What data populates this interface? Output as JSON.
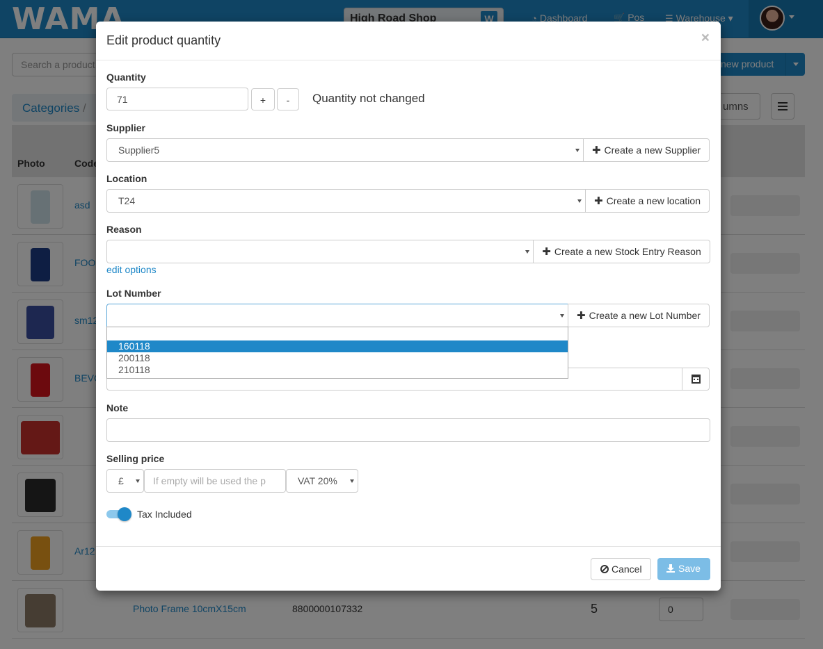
{
  "navbar": {
    "logo": "WAMA",
    "shop": "High Road Shop",
    "links": [
      {
        "icon": "dashboard-icon",
        "label": "Dashboard"
      },
      {
        "icon": "cart-icon",
        "label": "Pos"
      },
      {
        "icon": "bars-icon",
        "label": "Warehouse"
      }
    ]
  },
  "background": {
    "search_placeholder": "Search a product",
    "new_product": "new product",
    "breadcrumb": "Categories",
    "columns_btn": "umns",
    "headers": [
      "Photo",
      "Code"
    ],
    "rows": [
      {
        "code": "asd"
      },
      {
        "code": "FOO"
      },
      {
        "code": "sm12"
      },
      {
        "code": "BEVC"
      },
      {
        "code": ""
      },
      {
        "code": ""
      },
      {
        "code": "Ar12"
      },
      {
        "code": "Photo Frame 10cmX15cm",
        "barcode": "8800000107332",
        "stock": "5",
        "qty": "0"
      }
    ]
  },
  "modal": {
    "title": "Edit product quantity",
    "close": "×",
    "quantity": {
      "label": "Quantity",
      "value": "71",
      "plus": "+",
      "minus": "-",
      "status": "Quantity not changed"
    },
    "supplier": {
      "label": "Supplier",
      "value": "Supplier5",
      "create": "Create a new Supplier"
    },
    "location": {
      "label": "Location",
      "value": "T24",
      "create": "Create a new location"
    },
    "reason": {
      "label": "Reason",
      "value": "",
      "create": "Create a new Stock Entry Reason",
      "edit_link": "edit options"
    },
    "lot": {
      "label": "Lot Number",
      "value": "",
      "create": "Create a new Lot Number",
      "options": [
        "160118",
        "200118",
        "210118"
      ],
      "highlighted": "160118"
    },
    "note": {
      "label": "Note",
      "value": ""
    },
    "price": {
      "label": "Selling price",
      "currency": "£",
      "placeholder": "If empty will be used the p",
      "vat": "VAT 20%"
    },
    "tax": {
      "label": "Tax Included",
      "on": true
    },
    "footer": {
      "cancel": "Cancel",
      "save": "Save"
    }
  }
}
